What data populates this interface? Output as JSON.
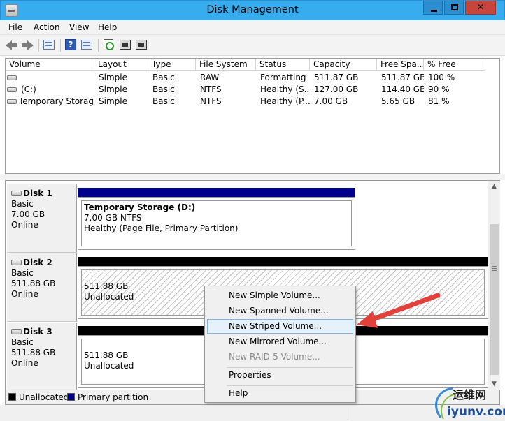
{
  "window": {
    "title": "Disk Management"
  },
  "menu": [
    "File",
    "Action",
    "View",
    "Help"
  ],
  "volume_table": {
    "columns": [
      "Volume",
      "Layout",
      "Type",
      "File System",
      "Status",
      "Capacity",
      "Free Spa...",
      "% Free"
    ],
    "rows": [
      [
        "",
        "Simple",
        "Basic",
        "RAW",
        "Formatting",
        "511.87 GB",
        "511.87 GB",
        "100 %"
      ],
      [
        "(C:)",
        "Simple",
        "Basic",
        "NTFS",
        "Healthy (S...",
        "127.00 GB",
        "114.40 GB",
        "90 %"
      ],
      [
        "Temporary Storag...",
        "Simple",
        "Basic",
        "NTFS",
        "Healthy (P...",
        "7.00 GB",
        "5.65 GB",
        "81 %"
      ]
    ]
  },
  "disks": [
    {
      "name": "Disk 1",
      "type": "Basic",
      "size": "7.00 GB",
      "status": "Online",
      "partition": {
        "title": "Temporary Storage  (D:)",
        "line2": "7.00 GB NTFS",
        "line3": "Healthy (Page File, Primary Partition)",
        "bar_color": "#00008b"
      }
    },
    {
      "name": "Disk 2",
      "type": "Basic",
      "size": "511.88 GB",
      "status": "Online",
      "partition": {
        "line2": "511.88 GB",
        "line3": "Unallocated",
        "bar_color": "#000000"
      }
    },
    {
      "name": "Disk 3",
      "type": "Basic",
      "size": "511.88 GB",
      "status": "Online",
      "partition": {
        "line2": "511.88 GB",
        "line3": "Unallocated",
        "bar_color": "#000000"
      }
    }
  ],
  "context_menu": {
    "items": [
      {
        "label": "New Simple Volume...",
        "enabled": true
      },
      {
        "label": "New Spanned Volume...",
        "enabled": true
      },
      {
        "label": "New Striped Volume...",
        "enabled": true,
        "highlighted": true
      },
      {
        "label": "New Mirrored Volume...",
        "enabled": true
      },
      {
        "label": "New RAID-5 Volume...",
        "enabled": false
      },
      {
        "label": "Properties",
        "enabled": true
      },
      {
        "label": "Help",
        "enabled": true
      }
    ]
  },
  "legend": [
    {
      "label": "Unallocated",
      "color": "#000000"
    },
    {
      "label": "Primary partition",
      "color": "#00008b"
    }
  ],
  "watermark": {
    "cn": "运维网",
    "en": "iyunv.com"
  },
  "colors": {
    "titlebar": "#37adef",
    "close_button": "#c7463c",
    "annotation_arrow": "#e2413b"
  },
  "icons": [
    "back-arrow-icon",
    "forward-arrow-icon",
    "console-tree-icon",
    "help-icon",
    "properties-icon",
    "refresh-icon",
    "export-list-icon",
    "settings-icon"
  ]
}
